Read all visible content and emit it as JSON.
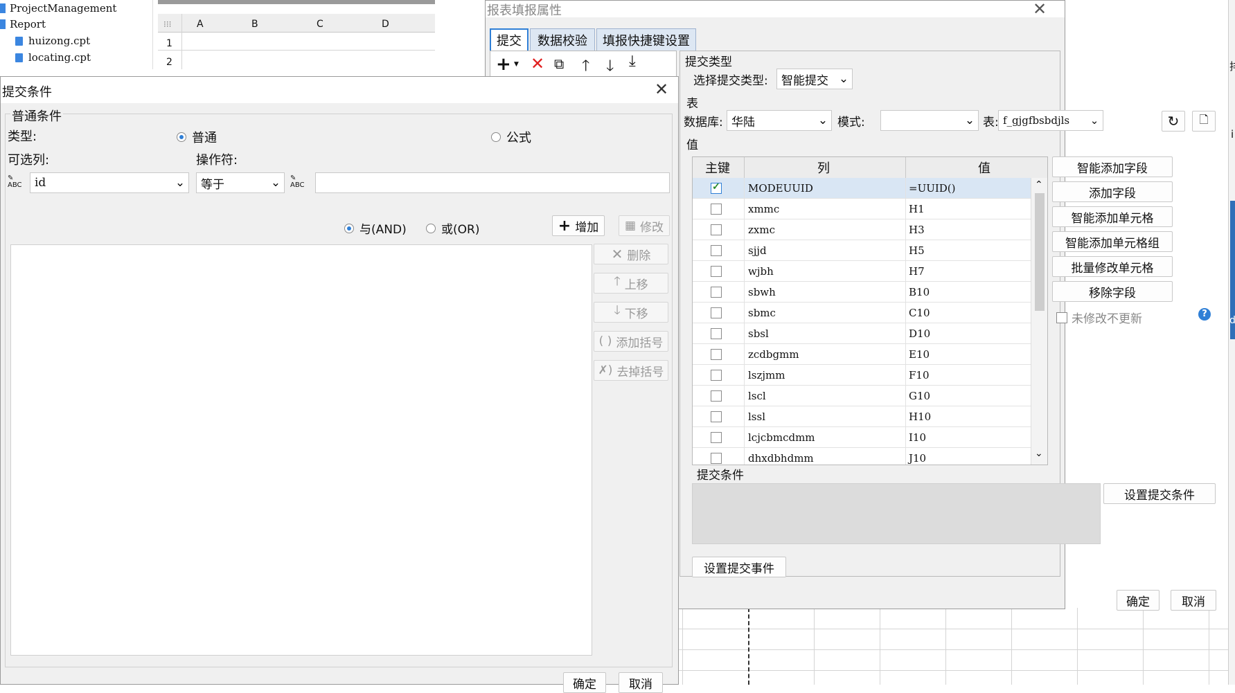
{
  "tree": {
    "items": [
      {
        "label": "ProjectManagement"
      },
      {
        "label": "Report"
      },
      {
        "label": "huizong.cpt"
      },
      {
        "label": "locating.cpt"
      }
    ]
  },
  "sheet": {
    "columns": [
      "A",
      "B",
      "C",
      "D"
    ],
    "rows": [
      "1",
      "2"
    ],
    "right_glyphs": [
      "排",
      "i",
      "d"
    ]
  },
  "report_dialog": {
    "title": "报表填报属性",
    "tabs": [
      {
        "label": "提交"
      },
      {
        "label": "数据校验"
      },
      {
        "label": "填报快捷键设置"
      }
    ],
    "submit_type_group": "提交类型",
    "select_type_label": "选择提交类型:",
    "select_type_value": "智能提交",
    "table_section": "表",
    "database_label": "数据库:",
    "database_value": "华陆",
    "mode_label": "模式:",
    "mode_value": "",
    "table_label": "表:",
    "table_value": "f_gjgfbsbdjls",
    "value_section": "值",
    "grid_headers": {
      "key": "主键",
      "column": "列",
      "value": "值"
    },
    "grid_rows": [
      {
        "checked": true,
        "column": "MODEUUID",
        "value": "=UUID()"
      },
      {
        "checked": false,
        "column": "xmmc",
        "value": "H1"
      },
      {
        "checked": false,
        "column": "zxmc",
        "value": "H3"
      },
      {
        "checked": false,
        "column": "sjjd",
        "value": "H5"
      },
      {
        "checked": false,
        "column": "wjbh",
        "value": "H7"
      },
      {
        "checked": false,
        "column": "sbwh",
        "value": "B10"
      },
      {
        "checked": false,
        "column": "sbmc",
        "value": "C10"
      },
      {
        "checked": false,
        "column": "sbsl",
        "value": "D10"
      },
      {
        "checked": false,
        "column": "zcdbgmm",
        "value": "E10"
      },
      {
        "checked": false,
        "column": "lszjmm",
        "value": "F10"
      },
      {
        "checked": false,
        "column": "lscl",
        "value": "G10"
      },
      {
        "checked": false,
        "column": "lssl",
        "value": "H10"
      },
      {
        "checked": false,
        "column": "lcjcbmcdmm",
        "value": "I10"
      },
      {
        "checked": false,
        "column": "dhxdbhdmm",
        "value": "J10"
      }
    ],
    "side_buttons": [
      {
        "label": "智能添加字段"
      },
      {
        "label": "添加字段"
      },
      {
        "label": "智能添加单元格"
      },
      {
        "label": "智能添加单元格组"
      },
      {
        "label": "批量修改单元格"
      },
      {
        "label": "移除字段"
      }
    ],
    "no_update_label": "未修改不更新",
    "submit_condition_section": "提交条件",
    "set_condition_button": "设置提交条件",
    "set_event_button": "设置提交事件",
    "ok_button": "确定",
    "cancel_button": "取消"
  },
  "cond_dialog": {
    "title": "提交条件",
    "group_title": "普通条件",
    "type_label": "类型:",
    "type_normal": "普通",
    "type_formula": "公式",
    "type_selected": "normal",
    "column_label": "可选列:",
    "operator_label": "操作符:",
    "column_value": "id",
    "operator_value": "等于",
    "value_input": "",
    "and_label": "与(AND)",
    "or_label": "或(OR)",
    "logic_selected": "and",
    "add_button": "增加",
    "modify_button": "修改",
    "delete_button": "删除",
    "up_button": "上移",
    "down_button": "下移",
    "add_paren_button": "添加括号",
    "remove_paren_button": "去掉括号",
    "ok_button": "确定",
    "cancel_button": "取消"
  },
  "colors": {
    "accent": "#2f7fd6",
    "selected_row": "#d9e6f4",
    "delete_red": "#e02020",
    "tab_active": "#ffffff",
    "tab_inactive": "#dde7f3"
  }
}
